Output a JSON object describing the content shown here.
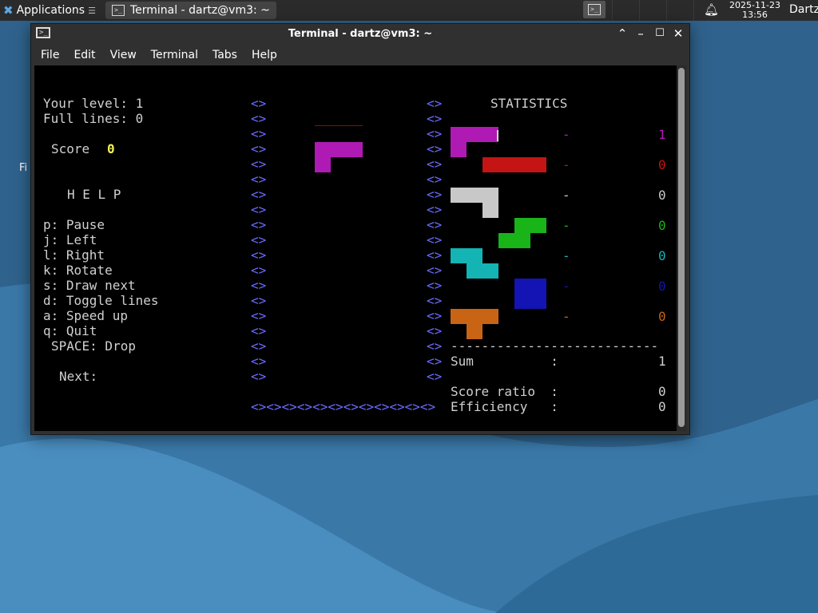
{
  "panel": {
    "apps_label": "Applications",
    "apps_suffix": "☰",
    "task_title": "Terminal - dartz@vm3: ~",
    "date": "2025-11-23",
    "time": "13:56",
    "user": "Dartz"
  },
  "desktop": {
    "label_fragment": "Fi"
  },
  "window": {
    "title": "Terminal - dartz@vm3: ~",
    "menu": [
      "File",
      "Edit",
      "View",
      "Terminal",
      "Tabs",
      "Help"
    ]
  },
  "tetris": {
    "level_line": "Your level: 1",
    "lines_line": "Full lines: 0",
    "score_label": "Score",
    "score_value": "0",
    "help_title": "H E L P",
    "help": [
      "p: Pause",
      "j: Left",
      "l: Right",
      "k: Rotate",
      "s: Draw next",
      "d: Toggle lines",
      "a: Speed up",
      "q: Quit"
    ],
    "space_drop": "SPACE: Drop",
    "next_label": "Next:",
    "wall_glyph": "<>",
    "floor": "<><><><><><><><><><><><>",
    "stats_title": "STATISTICS",
    "stats": [
      {
        "dash": "-",
        "count": "1",
        "color": "#b01ab4"
      },
      {
        "dash": "-",
        "count": "0",
        "color": "#c41414"
      },
      {
        "dash": "-",
        "count": "0",
        "color": "#c8c8c8"
      },
      {
        "dash": "-",
        "count": "0",
        "color": "#18b418"
      },
      {
        "dash": "-",
        "count": "0",
        "color": "#14b4b4"
      },
      {
        "dash": "-",
        "count": "0",
        "color": "#1414b4"
      },
      {
        "dash": "-",
        "count": "0",
        "color": "#c86414"
      }
    ],
    "separator": "---------------------------",
    "sum_label": "Sum          :",
    "sum_value": "1",
    "ratio_label": "Score ratio  :",
    "ratio_value": "0",
    "eff_label": "Efficiency   :",
    "eff_value": "0"
  },
  "colors": {
    "magenta": "#b01ab4",
    "red": "#c41414",
    "gray": "#c8c8c8",
    "green": "#18b418",
    "cyan": "#14b4b4",
    "blue": "#1414b4",
    "orange": "#c86414"
  }
}
